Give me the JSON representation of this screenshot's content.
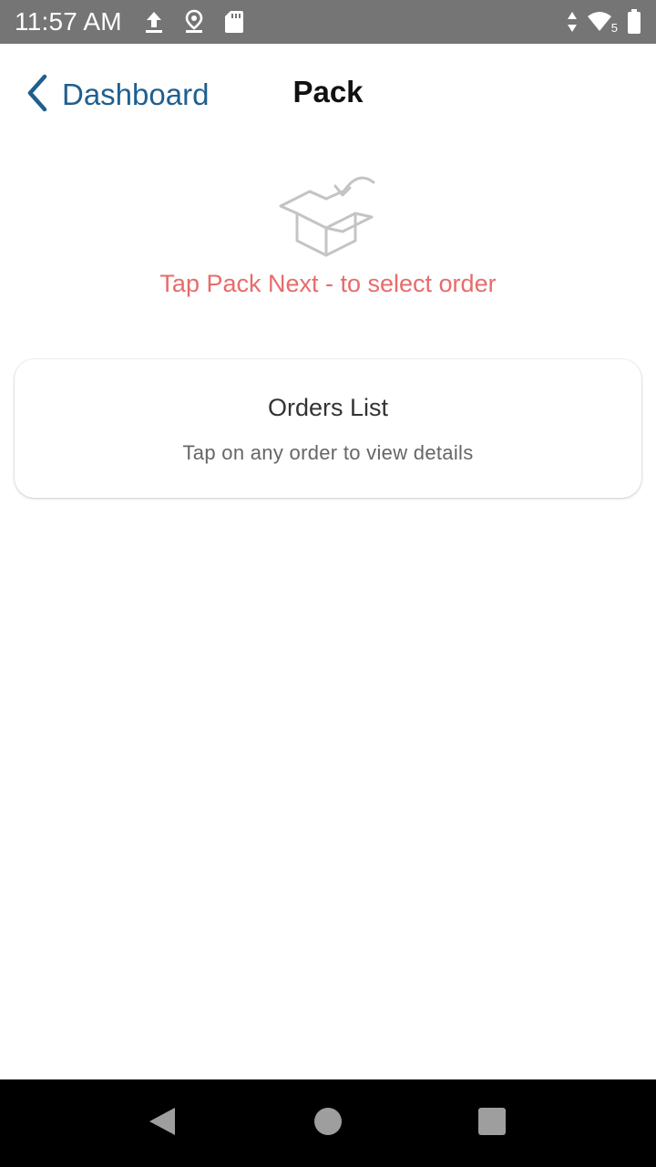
{
  "status_bar": {
    "time": "11:57 AM",
    "icons_left": [
      "upload-icon",
      "location-icon",
      "sd-card-icon"
    ],
    "icons_right": [
      "data-arrows-icon",
      "wifi-icon",
      "battery-icon"
    ],
    "wifi_badge": "5"
  },
  "header": {
    "back_label": "Dashboard",
    "title": "Pack"
  },
  "empty_state": {
    "icon": "open-box-icon",
    "hint": "Tap Pack Next - to select order"
  },
  "orders_card": {
    "title": "Orders List",
    "subtitle": "Tap on any order to view details"
  },
  "nav_bar": {
    "buttons": [
      "back-icon",
      "home-icon",
      "recent-apps-icon"
    ]
  },
  "colors": {
    "status_bar_bg": "#757575",
    "accent_blue": "#1f5f8f",
    "hint_red": "#e86b6b",
    "nav_bar_bg": "#000000"
  }
}
